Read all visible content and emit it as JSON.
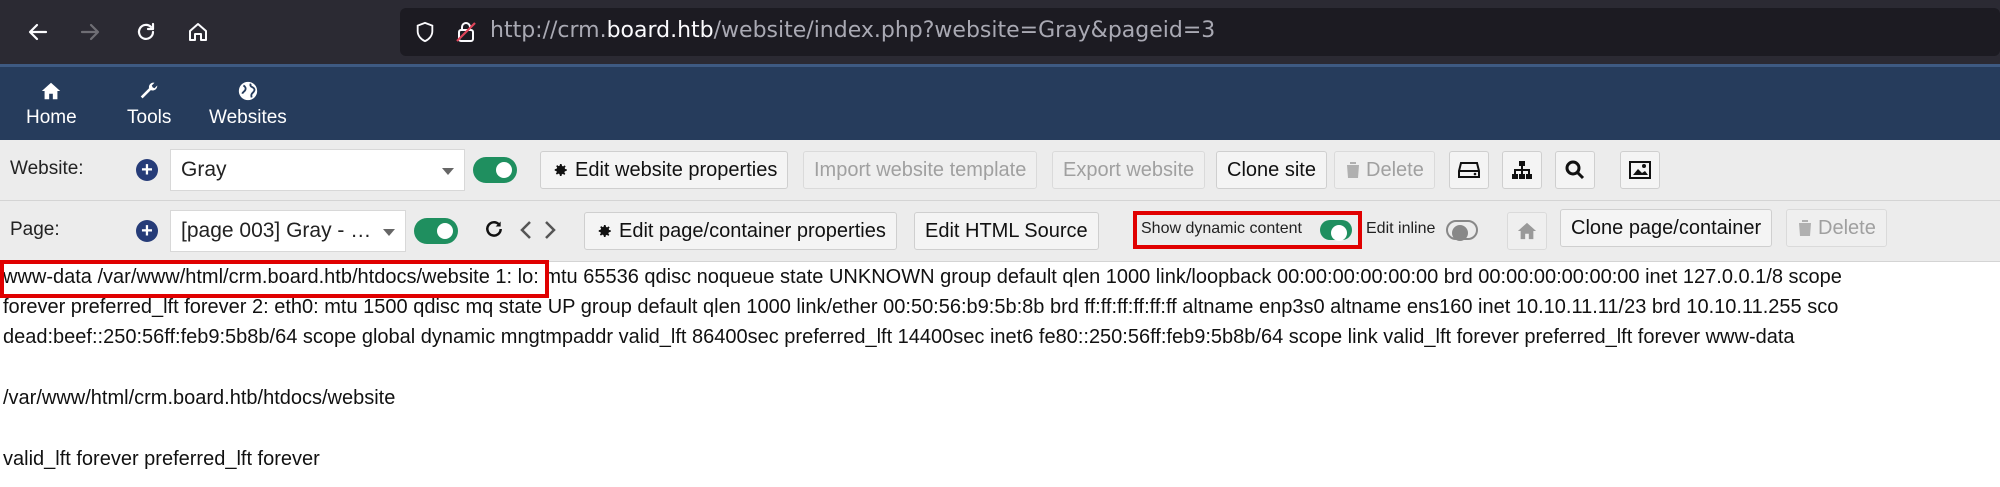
{
  "browser": {
    "url_prefix": "http://crm.",
    "url_host": "board.htb",
    "url_suffix": "/website/index.php?website=Gray&pageid=3"
  },
  "nav": {
    "items": [
      {
        "label": "Home",
        "icon": "home-icon"
      },
      {
        "label": "Tools",
        "icon": "wrench-icon"
      },
      {
        "label": "Websites",
        "icon": "globe-icon"
      }
    ]
  },
  "website_bar": {
    "label": "Website:",
    "selected": "Gray",
    "edit_properties": "Edit website properties",
    "import_template": "Import website template",
    "export": "Export website",
    "clone": "Clone site",
    "delete": "Delete"
  },
  "page_bar": {
    "label": "Page:",
    "selected": "[page 003] Gray - …",
    "edit_properties": "Edit page/container properties",
    "edit_html": "Edit HTML Source",
    "show_dynamic": "Show dynamic content",
    "edit_inline": "Edit inline",
    "clone": "Clone page/container",
    "delete": "Delete"
  },
  "content": {
    "line1_highlight": "www-data /var/www/html/crm.board.htb/htdocs/website",
    "line1_rest": "1: lo: mtu 65536 qdisc noqueue state UNKNOWN group default qlen 1000 link/loopback 00:00:00:00:00:00 brd 00:00:00:00:00:00 inet 127.0.0.1/8 scope",
    "line2": "forever preferred_lft forever 2: eth0: mtu 1500 qdisc mq state UP group default qlen 1000 link/ether 00:50:56:b9:5b:8b brd ff:ff:ff:ff:ff:ff altname enp3s0 altname ens160 inet 10.10.11.11/23 brd 10.10.11.255 sco",
    "line3": "dead:beef::250:56ff:feb9:5b8b/64 scope global dynamic mngtmpaddr valid_lft 86400sec preferred_lft 14400sec inet6 fe80::250:56ff:feb9:5b8b/64 scope link valid_lft forever preferred_lft forever www-data",
    "line4": "/var/www/html/crm.board.htb/htdocs/website",
    "line5": "valid_lft forever preferred_lft forever"
  },
  "colors": {
    "browser_bg": "#2b2a33",
    "nav_bg": "#263c5c",
    "toggle_on": "#1f8f5f",
    "highlight": "#e00000"
  }
}
